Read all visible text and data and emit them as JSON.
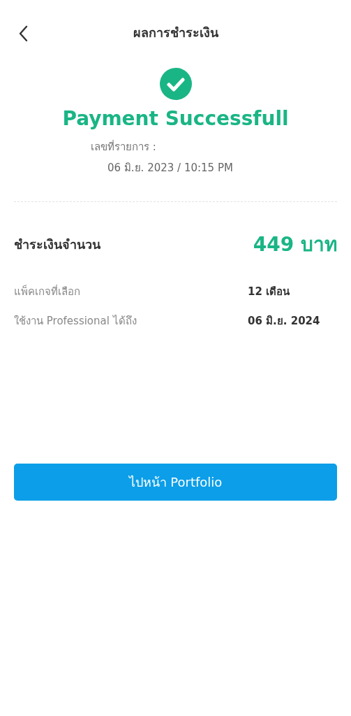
{
  "header": {
    "title": "ผลการชำระเงิน"
  },
  "status": {
    "kind": "success",
    "title": "Payment Successfull",
    "reference_label": "เลขที่รายการ :",
    "datetime": "06 มิ.ย. 2023 / 10:15 PM"
  },
  "amount": {
    "label": "ชำระเงินจำนวน",
    "value": "449 บาท"
  },
  "details": [
    {
      "label": "แพ็คเกจที่เลือก",
      "value": "12 เดือน"
    },
    {
      "label": "ใช้งาน Professional ได้ถึง",
      "value": "06 มิ.ย. 2024"
    }
  ],
  "button": {
    "label": "ไปหน้า Portfolio"
  }
}
